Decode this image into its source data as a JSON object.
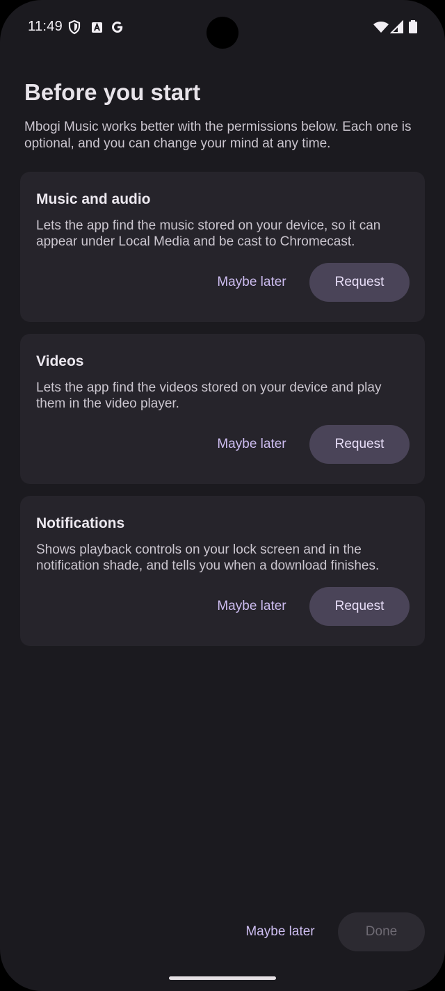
{
  "status_bar": {
    "time": "11:49",
    "icons": [
      "shield-icon",
      "font-a-icon",
      "google-g-icon",
      "wifi-icon",
      "signal-icon",
      "battery-icon"
    ]
  },
  "page": {
    "title": "Before you start",
    "subtitle": "Mbogi Music works better with the permissions below. Each one is optional, and you can change your mind at any time."
  },
  "permissions": [
    {
      "title": "Music and audio",
      "description": "Lets the app find the music stored on your device, so it can appear under Local Media and be cast to Chromecast.",
      "later_label": "Maybe later",
      "request_label": "Request"
    },
    {
      "title": "Videos",
      "description": "Lets the app find the videos stored on your device and play them in the video player.",
      "later_label": "Maybe later",
      "request_label": "Request"
    },
    {
      "title": "Notifications",
      "description": "Shows playback controls on your lock screen and in the notification shade, and tells you when a download finishes.",
      "later_label": "Maybe later",
      "request_label": "Request"
    }
  ],
  "footer": {
    "later_label": "Maybe later",
    "done_label": "Done",
    "done_enabled": false
  },
  "colors": {
    "background": "#1b1a1f",
    "card": "#26242b",
    "accent_text": "#cdbdf0",
    "tonal_button": "#4a4458",
    "disabled_button": "#2c2a31"
  }
}
